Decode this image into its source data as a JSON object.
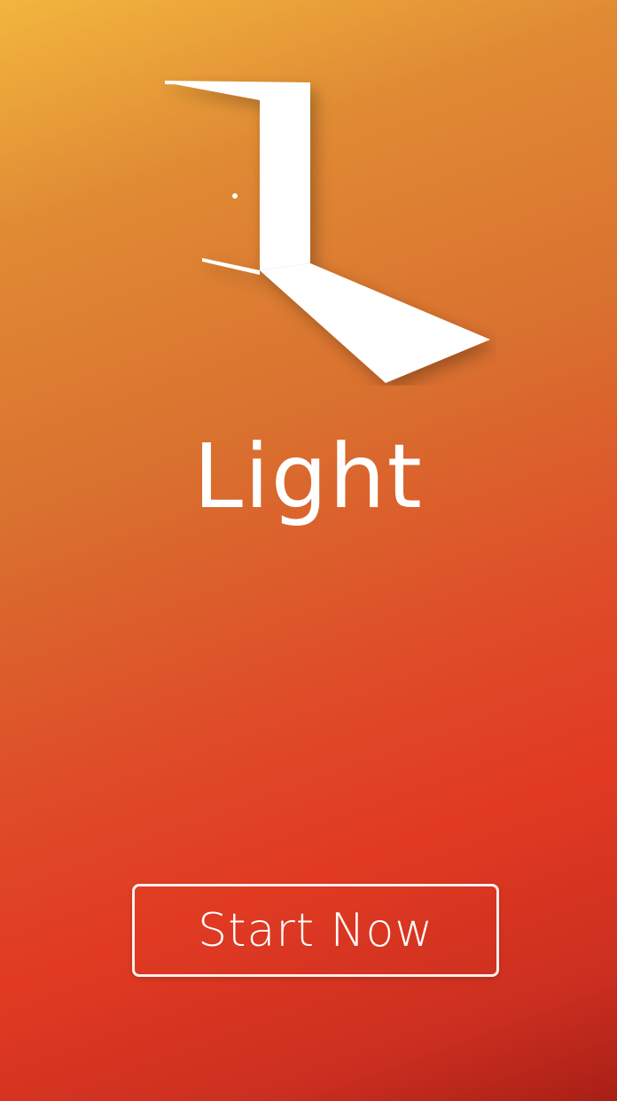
{
  "app": {
    "title": "Light"
  },
  "logo": {
    "icon": "open-door-icon",
    "color": "#ffffff"
  },
  "actions": {
    "start_label": "Start Now"
  },
  "colors": {
    "gradient_start": "#f2b63e",
    "gradient_mid": "#d9702f",
    "gradient_end": "#a81f16",
    "text": "#ffffff"
  }
}
